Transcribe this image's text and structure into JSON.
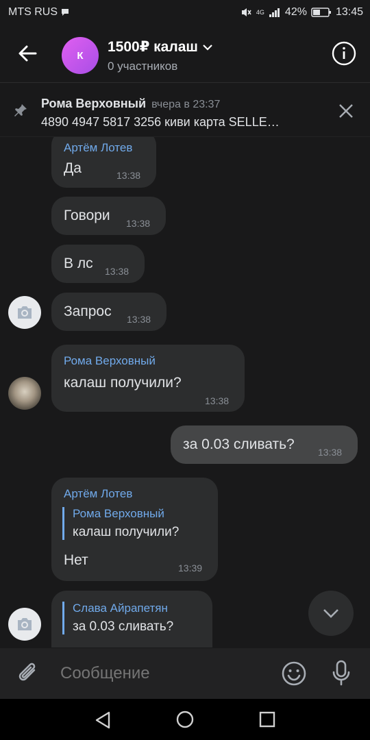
{
  "status": {
    "carrier": "MTS RUS",
    "network": "4G",
    "battery": "42%",
    "time": "13:45"
  },
  "header": {
    "avatar_letter": "К",
    "title": "1500₽ калаш",
    "subtitle": "0 участников"
  },
  "pinned": {
    "author": "Рома Верховный",
    "time": "вчера в 23:37",
    "text": "4890 4947 5817 3256 киви карта SELLE…"
  },
  "messages": [
    {
      "author": "Артём Лотев",
      "text": "Да",
      "time": "13:38"
    },
    {
      "text": "Говори",
      "time": "13:38"
    },
    {
      "text": "В лс",
      "time": "13:38"
    },
    {
      "text": "Запрос",
      "time": "13:38"
    },
    {
      "author": "Рома Верховный",
      "text": "калаш получили?",
      "time": "13:38"
    },
    {
      "text": "за 0.03 сливать?",
      "time": "13:38",
      "outgoing": true
    },
    {
      "author": "Артём Лотев",
      "reply_author": "Рома Верховный",
      "reply_text": "калаш получили?",
      "text": "Нет",
      "time": "13:39"
    },
    {
      "reply_author": "Слава Айрапетян",
      "reply_text": "за 0.03 сливать?"
    }
  ],
  "composer": {
    "placeholder": "Сообщение"
  },
  "icons": [
    "camera-icon",
    "pin-icon",
    "close-icon",
    "info-icon",
    "back-arrow-icon",
    "chevron-down-icon",
    "paperclip-icon",
    "emoji-icon",
    "mic-icon"
  ]
}
